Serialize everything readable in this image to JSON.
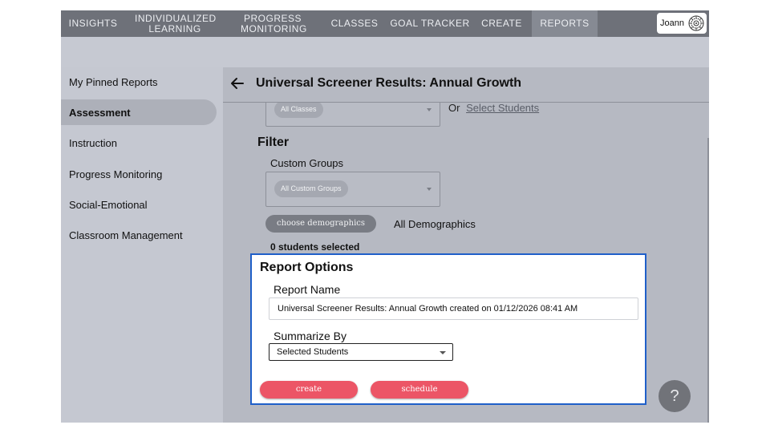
{
  "nav": {
    "items": [
      {
        "label": "INSIGHTS"
      },
      {
        "label": "INDIVIDUALIZED LEARNING"
      },
      {
        "label": "PROGRESS MONITORING"
      },
      {
        "label": "CLASSES"
      },
      {
        "label": "GOAL TRACKER"
      },
      {
        "label": "CREATE"
      },
      {
        "label": "REPORTS"
      }
    ],
    "active": "REPORTS",
    "user_name": "Joann",
    "avatar_icon": "mandala-avatar-icon"
  },
  "sidebar": {
    "items": [
      {
        "label": "My Pinned Reports"
      },
      {
        "label": "Assessment"
      },
      {
        "label": "Instruction"
      },
      {
        "label": "Progress Monitoring"
      },
      {
        "label": "Social-Emotional"
      },
      {
        "label": "Classroom Management"
      }
    ],
    "active": "Assessment"
  },
  "page": {
    "title": "Universal Screener Results: Annual Growth",
    "back_icon": "arrow-left-icon"
  },
  "classes": {
    "chip": "All Classes",
    "or_text": "Or",
    "select_students_link": "Select Students"
  },
  "filter": {
    "heading": "Filter",
    "custom_groups_label": "Custom Groups",
    "custom_groups_chip": "All Custom Groups",
    "choose_demographics_button": "choose demographics",
    "demographics_value": "All Demographics",
    "students_selected": "0 students selected"
  },
  "report_options": {
    "heading": "Report Options",
    "report_name_label": "Report Name",
    "report_name_value": "Universal Screener Results: Annual Growth created on 01/12/2026 08:41 AM",
    "summarize_label": "Summarize By",
    "summarize_value": "Selected Students",
    "create_button": "create",
    "schedule_button": "schedule"
  },
  "help": {
    "label": "?"
  },
  "colors": {
    "nav_bg": "#6e7179",
    "accent_blue": "#1f5fc9",
    "button_red": "#ec5566"
  }
}
